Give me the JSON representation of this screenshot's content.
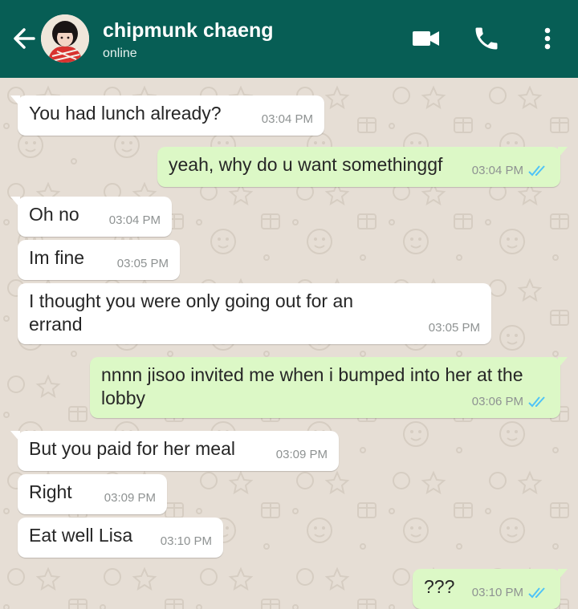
{
  "header": {
    "contact_name": "chipmunk chaeng",
    "status": "online",
    "colors": {
      "bar": "#075e55",
      "text": "#ffffff"
    },
    "icons": [
      "back-arrow-icon",
      "video-call-icon",
      "phone-icon",
      "more-vert-icon"
    ]
  },
  "messages": [
    {
      "dir": "in",
      "text": "You had lunch already?",
      "time": "03:04 PM"
    },
    {
      "dir": "out",
      "text": "yeah, why do u want somethinggf",
      "time": "03:04 PM",
      "read": true
    },
    {
      "dir": "in",
      "text": "Oh no",
      "time": "03:04 PM"
    },
    {
      "dir": "in",
      "text": "Im fine",
      "time": "03:05 PM"
    },
    {
      "dir": "in",
      "text": "I thought you were only going out for an errand",
      "time": "03:05 PM"
    },
    {
      "dir": "out",
      "text": "nnnn jisoo invited me when i bumped into her at the lobby",
      "time": "03:06 PM",
      "read": true
    },
    {
      "dir": "in",
      "text": "But you paid for her meal",
      "time": "03:09 PM"
    },
    {
      "dir": "in",
      "text": "Right",
      "time": "03:09 PM"
    },
    {
      "dir": "in",
      "text": "Eat well Lisa",
      "time": "03:10 PM"
    },
    {
      "dir": "out",
      "text": "???",
      "time": "03:10 PM",
      "read": true
    }
  ],
  "colors": {
    "incoming": "#ffffff",
    "outgoing": "#dcf8c6",
    "read_ticks": "#4fc3f7",
    "wallpaper": "#e6ded5"
  }
}
